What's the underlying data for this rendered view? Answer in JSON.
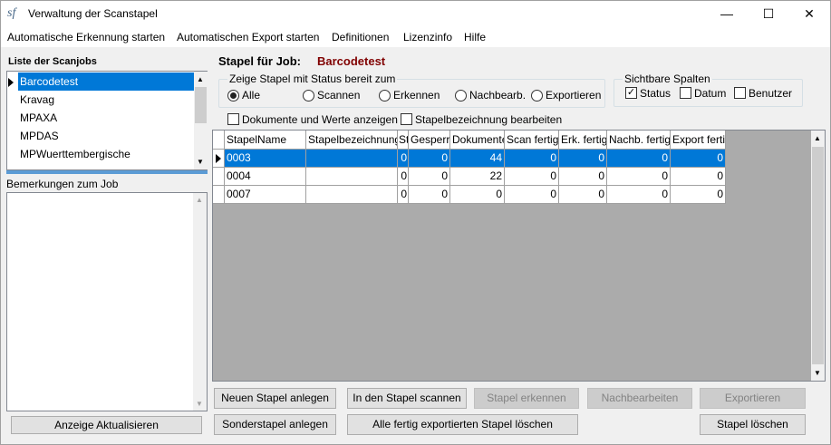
{
  "window": {
    "title": "Verwaltung der Scanstapel",
    "icon_text": "sf"
  },
  "menu": [
    "Automatische Erkennung starten",
    "Automatischen Export starten",
    "Definitionen",
    "Lizenzinfo",
    "Hilfe"
  ],
  "left": {
    "jobs_label": "Liste der Scanjobs",
    "jobs": [
      "Barcodetest",
      "Kravag",
      "MPAXA",
      "MPDAS",
      "MPWuerttembergische"
    ],
    "selected_job": "Barcodetest",
    "remarks_label": "Bemerkungen zum Job",
    "refresh_button": "Anzeige Aktualisieren"
  },
  "main": {
    "stapel_label": "Stapel für Job:",
    "job_name": "Barcodetest",
    "status_group": {
      "title": "Zeige Stapel mit Status bereit zum",
      "options": [
        "Alle",
        "Scannen",
        "Erkennen",
        "Nachbearb.",
        "Exportieren"
      ],
      "selected": "Alle"
    },
    "columns_group": {
      "title": "Sichtbare Spalten",
      "options": [
        {
          "label": "Status",
          "checked": true
        },
        {
          "label": "Datum",
          "checked": false
        },
        {
          "label": "Benutzer",
          "checked": false
        }
      ]
    },
    "check_documents": {
      "label": "Dokumente und Werte anzeigen",
      "checked": false
    },
    "check_edit_name": {
      "label": "Stapelbezeichnung bearbeiten",
      "checked": false
    }
  },
  "grid": {
    "columns": [
      "StapelName",
      "Stapelbezeichnung",
      "St",
      "Gesperrt",
      "Dokumente",
      "Scan fertig",
      "Erk. fertig",
      "Nachb. fertig",
      "Export fertig"
    ],
    "rows": [
      [
        "0003",
        "",
        "0",
        "0",
        "44",
        "0",
        "0",
        "0",
        "0"
      ],
      [
        "0004",
        "",
        "0",
        "0",
        "22",
        "0",
        "0",
        "0",
        "0"
      ],
      [
        "0007",
        "",
        "0",
        "0",
        "0",
        "0",
        "0",
        "0",
        "0"
      ]
    ],
    "selected_row": 0
  },
  "buttons": {
    "new_stack": "Neuen Stapel anlegen",
    "scan_into": "In den Stapel scannen",
    "recognize": "Stapel erkennen",
    "postprocess": "Nachbearbeiten",
    "export": "Exportieren",
    "special_stack": "Sonderstapel anlegen",
    "delete_exported": "Alle fertig exportierten Stapel löschen",
    "delete_stack": "Stapel löschen"
  },
  "colors": {
    "accent": "#0078d7",
    "job_name": "#800000"
  }
}
